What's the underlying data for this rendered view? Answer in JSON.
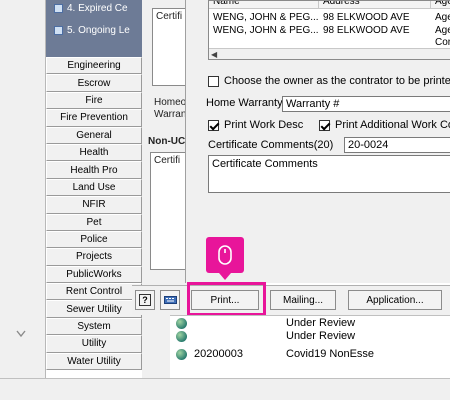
{
  "reports": [
    {
      "label": "4. Expired Ce"
    },
    {
      "label": "5. Ongoing Le"
    }
  ],
  "modules": [
    {
      "label": "Engineering"
    },
    {
      "label": "Escrow"
    },
    {
      "label": "Fire"
    },
    {
      "label": "Fire Prevention"
    },
    {
      "label": "General"
    },
    {
      "label": "Health"
    },
    {
      "label": "Health Pro"
    },
    {
      "label": "Land Use"
    },
    {
      "label": "NFIR"
    },
    {
      "label": "Pet"
    },
    {
      "label": "Police"
    },
    {
      "label": "Projects"
    },
    {
      "label": "PublicWorks"
    },
    {
      "label": "Rent Control"
    },
    {
      "label": "Sewer Utility"
    },
    {
      "label": "System"
    },
    {
      "label": "Utility"
    },
    {
      "label": "Water Utility"
    }
  ],
  "background_form": {
    "certificate_header": "Certifi",
    "homeowner_label": "Homeow",
    "warranty_label": "Warran",
    "non_uc_label": "Non-UC",
    "certificate_header2": "Certifi"
  },
  "owner_grid": {
    "columns": [
      "Name",
      "Address",
      "Age"
    ],
    "rows": [
      {
        "name": "WENG, JOHN & PEG...",
        "address": "98 ELKWOOD AVE",
        "agent": "Age"
      },
      {
        "name": "WENG, JOHN & PEG...",
        "address": "98 ELKWOOD AVE",
        "agent": "Age"
      },
      {
        "name": "",
        "address": "",
        "agent": "Cor"
      }
    ]
  },
  "dialog": {
    "choose_owner_label": "Choose the owner as the contrator to be printed on",
    "choose_owner_checked": false,
    "home_warranty_label": "Home Warranty:",
    "home_warranty_value": "Warranty #",
    "print_work_desc_label": "Print Work Desc",
    "print_work_desc_checked": true,
    "print_additional_label": "Print Additional Work Com",
    "print_additional_checked": true,
    "certificate_comments_label": "Certificate Comments(20)",
    "certificate_comments_code": "20-0024",
    "certificate_comments_text": "Certificate Comments"
  },
  "buttons": {
    "help": "?",
    "print": "Print...",
    "mailing": "Mailing...",
    "application": "Application..."
  },
  "lower_list": [
    {
      "id": "",
      "status": "Under Review"
    },
    {
      "id": "",
      "status": "Under Review"
    },
    {
      "id": "20200003",
      "status": "Covid19 NonEsse"
    }
  ],
  "colors": {
    "highlight": "#e8159a",
    "reports_panel": "#6d7b96"
  },
  "icons": {
    "cursor": "mouse-icon",
    "help": "help-icon",
    "keyboard": "keyboard-icon",
    "globe": "globe-icon"
  }
}
